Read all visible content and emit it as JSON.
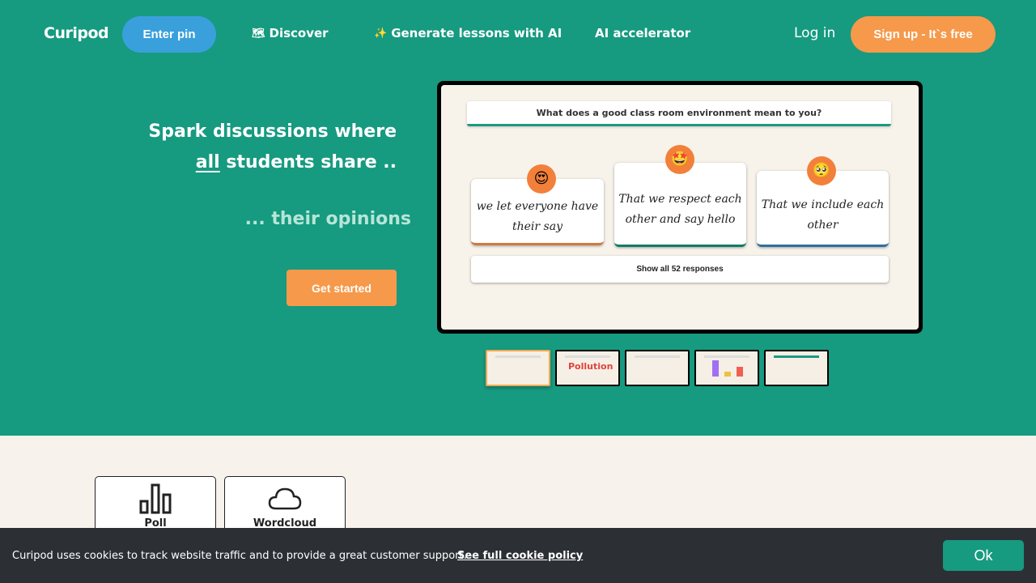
{
  "nav": {
    "logo": "Curipod",
    "enter_pin": "Enter pin",
    "discover": "Discover",
    "discover_icon": "map-icon",
    "generate": "Generate lessons with AI",
    "generate_icon": "magic-wand-icon",
    "ai_accelerator": "AI accelerator",
    "login": "Log in",
    "signup": "Sign up - It`s free"
  },
  "hero": {
    "headline_line1": "Spark discussions where",
    "headline_line2_em": "all",
    "headline_line2_rest": " students share ..",
    "tagline": "... their opinions",
    "cta": "Get started"
  },
  "preview": {
    "question": "What does a good class room environment mean to you?",
    "responses": [
      {
        "text": "we let everyone have their say",
        "emoji": "heart-eyes",
        "accent": "#d07a40"
      },
      {
        "text": "That we respect each other and say hello",
        "emoji": "star-eyes",
        "accent": "#137a68"
      },
      {
        "text": "That we include each other",
        "emoji": "pleading",
        "accent": "#2f6fa3"
      }
    ],
    "show_all": "Show all 52 responses"
  },
  "thumbnails": [
    {
      "name": "thumb-responses",
      "active": true
    },
    {
      "name": "thumb-wordcloud",
      "word": "Pollution",
      "active": false
    },
    {
      "name": "thumb-drawings",
      "active": false
    },
    {
      "name": "thumb-poll",
      "active": false
    },
    {
      "name": "thumb-text-responses",
      "active": false
    }
  ],
  "question_types": [
    {
      "label": "Poll",
      "icon": "bar-chart-icon"
    },
    {
      "label": "Wordcloud",
      "icon": "cloud-icon"
    }
  ],
  "cookie": {
    "text": "Curipod uses cookies to track website traffic and to provide a great customer support.",
    "link": "See full cookie policy",
    "ok": "Ok"
  },
  "colors": {
    "brand_green": "#169a80",
    "accent_orange": "#f6994a",
    "pin_blue": "#3aa0dc",
    "cookie_bg": "#2c3035"
  }
}
